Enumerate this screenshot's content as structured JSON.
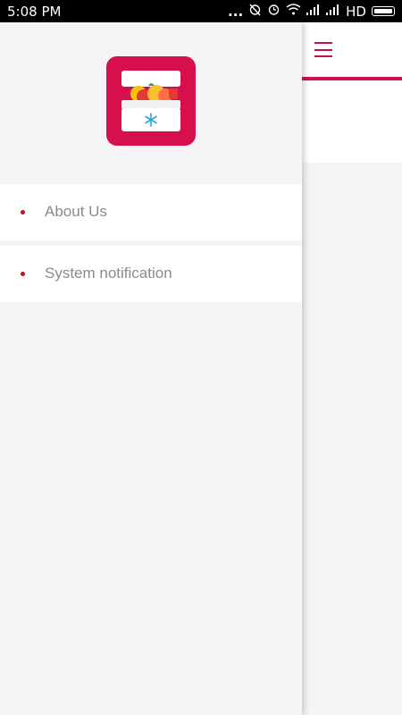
{
  "status_bar": {
    "time": "5:08  PM",
    "dots": "...",
    "network": "HD",
    "icons": [
      "alarm-off-icon",
      "alarm-icon",
      "wifi-icon",
      "signal-icon",
      "signal-icon",
      "battery-icon"
    ]
  },
  "colors": {
    "accent": "#c8134f",
    "logo_bg": "#d6104c",
    "bullet": "#c4101e",
    "drawer_bg": "#f5f4f7",
    "menu_text": "#8a8a8f"
  },
  "app": {
    "menu_icon": "hamburger-menu-icon"
  },
  "drawer": {
    "logo_icon": "fridge-with-fruit-icon",
    "items": [
      {
        "label": "About Us"
      },
      {
        "label": "System notification"
      }
    ]
  }
}
